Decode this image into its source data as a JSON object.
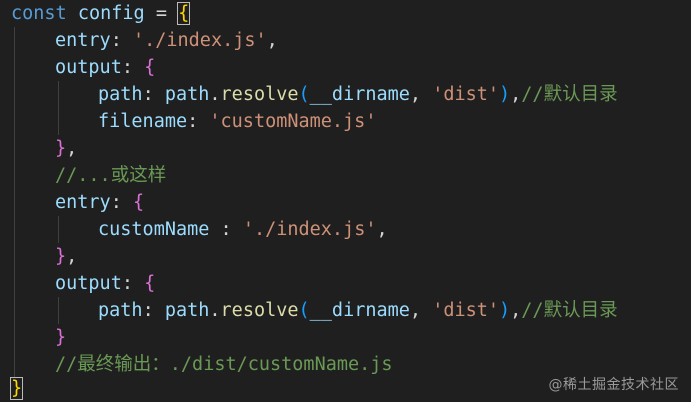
{
  "code": {
    "l1": {
      "kw": "const",
      "name": "config",
      "op": "=",
      "brace": "{"
    },
    "l2": {
      "key": "entry",
      "colon": ":",
      "value": "'./index.js'",
      "comma": ","
    },
    "l3": {
      "key": "output",
      "colon": ":",
      "brace": "{"
    },
    "l4": {
      "key": "path",
      "colon": ":",
      "obj": "path",
      "dot": ".",
      "fn": "resolve",
      "paren_open": "(",
      "arg1": "__dirname",
      "sep": ",",
      "arg2": "'dist'",
      "paren_close": ")",
      "comma": ",",
      "comment": "//默认目录"
    },
    "l5": {
      "key": "filename",
      "colon": ":",
      "value": "'customName.js'"
    },
    "l6": {
      "brace": "}",
      "comma": ","
    },
    "l7": {
      "comment": "//...或这样"
    },
    "l8": {
      "key": "entry",
      "colon": ":",
      "brace": "{"
    },
    "l9": {
      "key": "customName",
      "colon": " :",
      "value": "'./index.js'",
      "comma": ","
    },
    "l10": {
      "brace": "}",
      "comma": ","
    },
    "l11": {
      "key": "output",
      "colon": ":",
      "brace": "{"
    },
    "l12": {
      "key": "path",
      "colon": ":",
      "obj": "path",
      "dot": ".",
      "fn": "resolve",
      "paren_open": "(",
      "arg1": "__dirname",
      "sep": ",",
      "arg2": "'dist'",
      "paren_close": ")",
      "comma": ",",
      "comment": "//默认目录"
    },
    "l13": {
      "brace": "}"
    },
    "l14": {
      "comment": "//最终输出：./dist/customName.js"
    },
    "l15": {
      "brace": "}"
    }
  },
  "watermark": "@稀土掘金技术社区",
  "colors": {
    "background": "#1f1f1f",
    "keyword": "#569cd6",
    "variable": "#9cdcfe",
    "string": "#ce9178",
    "function": "#dcdcaa",
    "comment": "#6a9955",
    "bracket_level1": "#ffd700",
    "bracket_level2": "#da70d6",
    "bracket_level3": "#179fff"
  }
}
